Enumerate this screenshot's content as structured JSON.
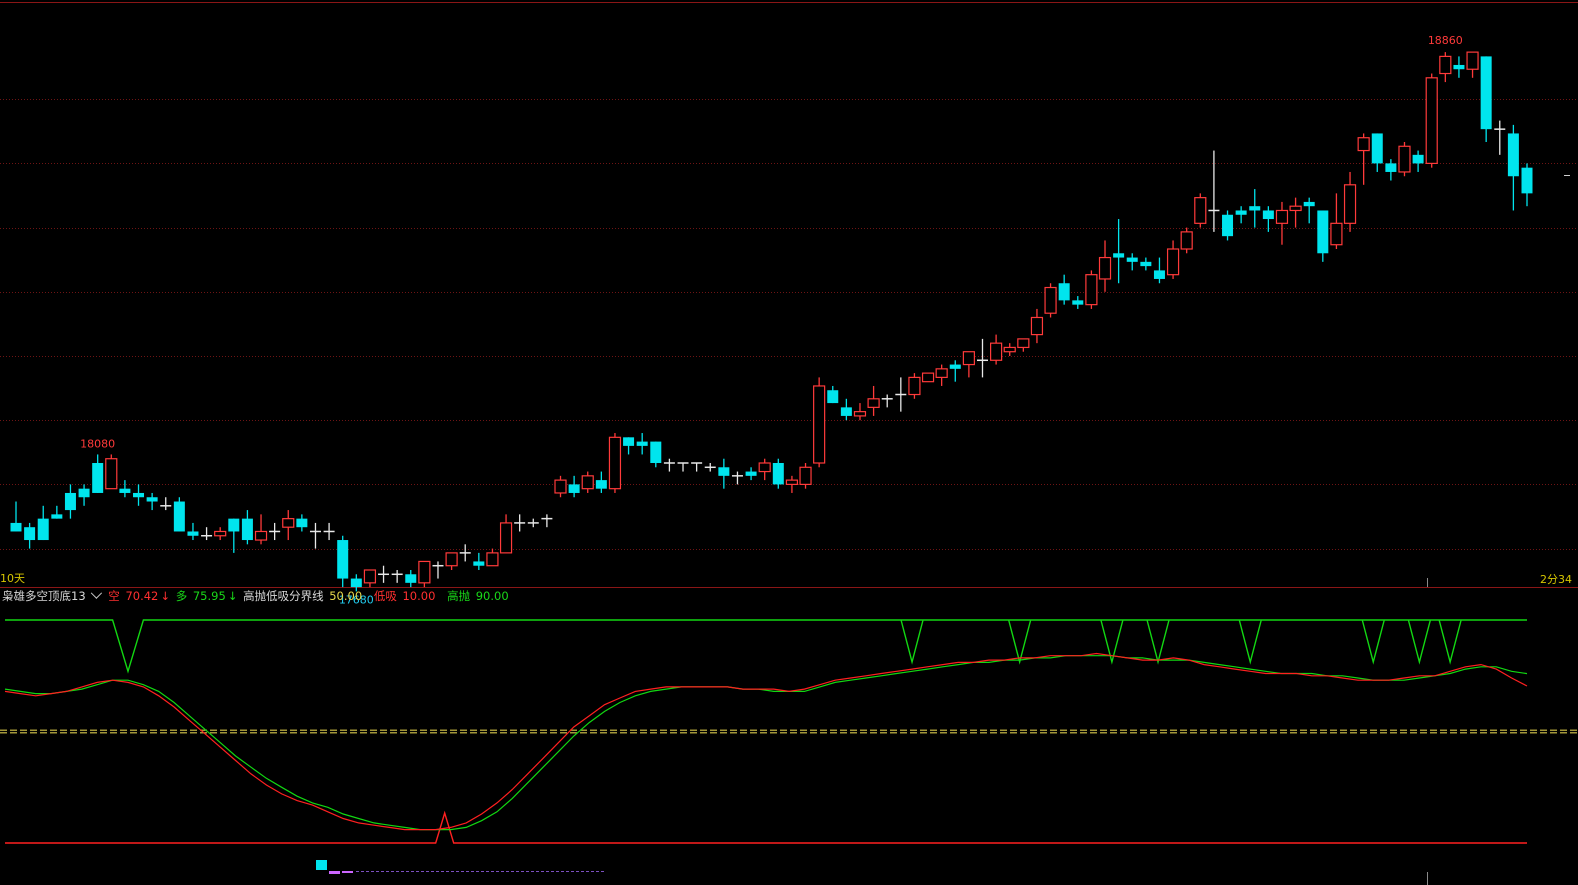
{
  "main_panel": {
    "period_label": "10天",
    "right_label": "2分34",
    "high_label": "18860",
    "local_high_label": "18080",
    "low_label": "17680"
  },
  "indicator": {
    "name": "枭雄多空顶底13",
    "kong_label": "空",
    "kong_value": "70.42",
    "kong_arrow": "↓",
    "duo_label": "多",
    "duo_value": "75.95",
    "duo_arrow": "↓",
    "line_label": "高抛低吸分界线",
    "line_value": "50.00",
    "low_label": "低吸",
    "low_value": "10.00",
    "high_label": "高抛",
    "high_value": "90.00"
  },
  "colors": {
    "up": "#ff3a3a",
    "down": "#00e5ee",
    "doji": "#e8e8e8",
    "ind_green": "#12d712",
    "ind_red": "#ff2020",
    "mid_line": "#d8c84c",
    "label_yellow": "#d6c600",
    "high_label": "#ff3a3a",
    "low_label": "#22cdf0"
  },
  "chart_data": [
    {
      "type": "candlestick",
      "ylim": [
        17650,
        18900
      ],
      "candles": [
        [
          17760,
          17740,
          17810,
          17740
        ],
        [
          17750,
          17720,
          17760,
          17700
        ],
        [
          17770,
          17720,
          17800,
          17720
        ],
        [
          17780,
          17770,
          17800,
          17770
        ],
        [
          17830,
          17790,
          17850,
          17770
        ],
        [
          17840,
          17820,
          17850,
          17800
        ],
        [
          17900,
          17830,
          17920,
          17830
        ],
        [
          17840,
          17910,
          17920,
          17840
        ],
        [
          17840,
          17830,
          17860,
          17820
        ],
        [
          17830,
          17820,
          17850,
          17800
        ],
        [
          17820,
          17810,
          17830,
          17790
        ],
        [
          17800,
          17800,
          17820,
          17790
        ],
        [
          17810,
          17740,
          17820,
          17740
        ],
        [
          17740,
          17730,
          17760,
          17720
        ],
        [
          17730,
          17730,
          17750,
          17720
        ],
        [
          17730,
          17740,
          17750,
          17720
        ],
        [
          17770,
          17740,
          17770,
          17690
        ],
        [
          17770,
          17720,
          17790,
          17710
        ],
        [
          17720,
          17740,
          17780,
          17710
        ],
        [
          17740,
          17740,
          17760,
          17720
        ],
        [
          17750,
          17770,
          17790,
          17720
        ],
        [
          17770,
          17750,
          17780,
          17740
        ],
        [
          17740,
          17740,
          17760,
          17700
        ],
        [
          17740,
          17740,
          17760,
          17720
        ],
        [
          17720,
          17630,
          17730,
          17610
        ],
        [
          17630,
          17610,
          17640,
          17600
        ],
        [
          17620,
          17650,
          17650,
          17610
        ],
        [
          17640,
          17640,
          17660,
          17620
        ],
        [
          17640,
          17640,
          17650,
          17620
        ],
        [
          17640,
          17620,
          17650,
          17610
        ],
        [
          17620,
          17670,
          17670,
          17610
        ],
        [
          17660,
          17660,
          17670,
          17630
        ],
        [
          17660,
          17690,
          17690,
          17650
        ],
        [
          17690,
          17690,
          17710,
          17670
        ],
        [
          17670,
          17660,
          17690,
          17650
        ],
        [
          17660,
          17690,
          17700,
          17660
        ],
        [
          17690,
          17760,
          17780,
          17690
        ],
        [
          17760,
          17760,
          17780,
          17740
        ],
        [
          17760,
          17760,
          17770,
          17750
        ],
        [
          17770,
          17770,
          17780,
          17750
        ],
        [
          17830,
          17860,
          17870,
          17820
        ],
        [
          17850,
          17830,
          17870,
          17820
        ],
        [
          17840,
          17870,
          17880,
          17830
        ],
        [
          17860,
          17840,
          17880,
          17830
        ],
        [
          17840,
          17960,
          17970,
          17830
        ],
        [
          17960,
          17940,
          17960,
          17920
        ],
        [
          17950,
          17940,
          17970,
          17920
        ],
        [
          17950,
          17900,
          17950,
          17890
        ],
        [
          17900,
          17900,
          17910,
          17880
        ],
        [
          17900,
          17900,
          17900,
          17880
        ],
        [
          17900,
          17900,
          17900,
          17880
        ],
        [
          17890,
          17890,
          17900,
          17880
        ],
        [
          17890,
          17870,
          17910,
          17840
        ],
        [
          17870,
          17870,
          17880,
          17850
        ],
        [
          17880,
          17870,
          17890,
          17860
        ],
        [
          17880,
          17900,
          17910,
          17860
        ],
        [
          17900,
          17850,
          17910,
          17840
        ],
        [
          17850,
          17860,
          17870,
          17830
        ],
        [
          17850,
          17890,
          17900,
          17840
        ],
        [
          17900,
          18080,
          18100,
          17890
        ],
        [
          18070,
          18040,
          18080,
          18040
        ],
        [
          18030,
          18010,
          18050,
          18000
        ],
        [
          18010,
          18020,
          18040,
          18000
        ],
        [
          18030,
          18050,
          18080,
          18010
        ],
        [
          18050,
          18050,
          18060,
          18030
        ],
        [
          18060,
          18060,
          18100,
          18020
        ],
        [
          18060,
          18100,
          18110,
          18050
        ],
        [
          18090,
          18110,
          18110,
          18090
        ],
        [
          18100,
          18120,
          18130,
          18080
        ],
        [
          18130,
          18120,
          18140,
          18090
        ],
        [
          18130,
          18160,
          18150,
          18100
        ],
        [
          18140,
          18140,
          18190,
          18100
        ],
        [
          18140,
          18180,
          18200,
          18130
        ],
        [
          18160,
          18170,
          18180,
          18150
        ],
        [
          18170,
          18190,
          18190,
          18160
        ],
        [
          18200,
          18240,
          18260,
          18180
        ],
        [
          18250,
          18310,
          18320,
          18240
        ],
        [
          18320,
          18280,
          18340,
          18270
        ],
        [
          18280,
          18270,
          18290,
          18260
        ],
        [
          18270,
          18340,
          18350,
          18260
        ],
        [
          18330,
          18380,
          18420,
          18300
        ],
        [
          18390,
          18380,
          18470,
          18320
        ],
        [
          18380,
          18370,
          18390,
          18350
        ],
        [
          18370,
          18360,
          18380,
          18350
        ],
        [
          18350,
          18330,
          18380,
          18320
        ],
        [
          18340,
          18400,
          18420,
          18330
        ],
        [
          18400,
          18440,
          18450,
          18390
        ],
        [
          18460,
          18520,
          18530,
          18450
        ],
        [
          18490,
          18490,
          18630,
          18440
        ],
        [
          18480,
          18430,
          18490,
          18420
        ],
        [
          18490,
          18480,
          18500,
          18460
        ],
        [
          18500,
          18490,
          18540,
          18450
        ],
        [
          18490,
          18470,
          18500,
          18440
        ],
        [
          18460,
          18490,
          18510,
          18410
        ],
        [
          18490,
          18500,
          18520,
          18450
        ],
        [
          18510,
          18500,
          18520,
          18460
        ],
        [
          18490,
          18390,
          18490,
          18370
        ],
        [
          18410,
          18460,
          18530,
          18400
        ],
        [
          18460,
          18550,
          18580,
          18440
        ],
        [
          18630,
          18660,
          18670,
          18550
        ],
        [
          18670,
          18600,
          18670,
          18580
        ],
        [
          18600,
          18580,
          18610,
          18560
        ],
        [
          18580,
          18640,
          18650,
          18570
        ],
        [
          18620,
          18600,
          18630,
          18580
        ],
        [
          18600,
          18800,
          18810,
          18590
        ],
        [
          18810,
          18850,
          18860,
          18790
        ],
        [
          18830,
          18820,
          18850,
          18800
        ],
        [
          18820,
          18860,
          18860,
          18800
        ],
        [
          18850,
          18680,
          18850,
          18650
        ],
        [
          18680,
          18680,
          18700,
          18620
        ],
        [
          18670,
          18570,
          18690,
          18490
        ],
        [
          18590,
          18530,
          18600,
          18500
        ]
      ]
    },
    {
      "type": "line",
      "ylim": [
        0,
        100
      ],
      "hlines": [
        10,
        50,
        90
      ],
      "series": [
        {
          "name": "空",
          "values": [
            68,
            67,
            66,
            67,
            68,
            70,
            72,
            73,
            72,
            70,
            66,
            61,
            55,
            49,
            43,
            37,
            31,
            26,
            22,
            19,
            17,
            14,
            11,
            9,
            8,
            7,
            6,
            6,
            6,
            7,
            9,
            13,
            18,
            24,
            31,
            38,
            45,
            52,
            57,
            62,
            65,
            68,
            69,
            70,
            70,
            70,
            70,
            70,
            69,
            69,
            69,
            68,
            69,
            71,
            73,
            74,
            75,
            76,
            77,
            78,
            79,
            80,
            81,
            81,
            82,
            82,
            83,
            83,
            84,
            84,
            84,
            85,
            84,
            83,
            82,
            82,
            83,
            82,
            80,
            79,
            78,
            77,
            76,
            76,
            76,
            75,
            75,
            74,
            73,
            73,
            73,
            74,
            75,
            75,
            77,
            79,
            80,
            78,
            74,
            70.42
          ]
        },
        {
          "name": "多",
          "values": [
            69,
            68,
            67,
            67,
            68,
            69,
            71,
            73,
            73,
            71,
            68,
            63,
            57,
            51,
            45,
            39,
            34,
            29,
            25,
            21,
            18,
            16,
            13,
            11,
            9,
            8,
            7,
            6,
            6,
            6,
            7,
            10,
            14,
            20,
            27,
            34,
            41,
            48,
            54,
            59,
            63,
            66,
            68,
            69,
            70,
            70,
            70,
            70,
            69,
            69,
            68,
            68,
            68,
            70,
            72,
            73,
            74,
            75,
            76,
            77,
            78,
            79,
            80,
            81,
            81,
            82,
            82,
            83,
            83,
            84,
            84,
            84,
            84,
            83,
            83,
            82,
            82,
            82,
            81,
            80,
            79,
            78,
            77,
            76,
            76,
            76,
            75,
            75,
            74,
            73,
            73,
            73,
            74,
            75,
            76,
            78,
            79,
            79,
            77,
            75.95
          ]
        },
        {
          "name": "顶",
          "values": [
            100,
            100,
            100,
            100,
            100,
            100,
            100,
            100,
            77,
            100,
            100,
            100,
            100,
            100,
            100,
            100,
            100,
            100,
            100,
            100,
            100,
            100,
            100,
            100,
            100,
            100,
            100,
            100,
            100,
            100,
            100,
            100,
            100,
            100,
            100,
            100,
            100,
            100,
            100,
            100,
            100,
            100,
            100,
            100,
            100,
            100,
            100,
            100,
            100,
            100,
            100,
            100,
            100,
            100,
            100,
            100,
            100,
            100,
            100,
            100,
            100,
            100,
            100,
            100,
            100,
            100,
            100,
            100,
            100,
            100,
            100,
            100,
            100,
            100,
            100,
            100,
            100,
            100,
            100,
            100,
            100,
            100,
            100,
            100,
            100,
            100,
            100,
            100,
            100,
            100,
            100,
            100,
            100,
            100,
            100,
            100,
            100,
            100,
            100,
            100
          ]
        }
      ]
    }
  ]
}
